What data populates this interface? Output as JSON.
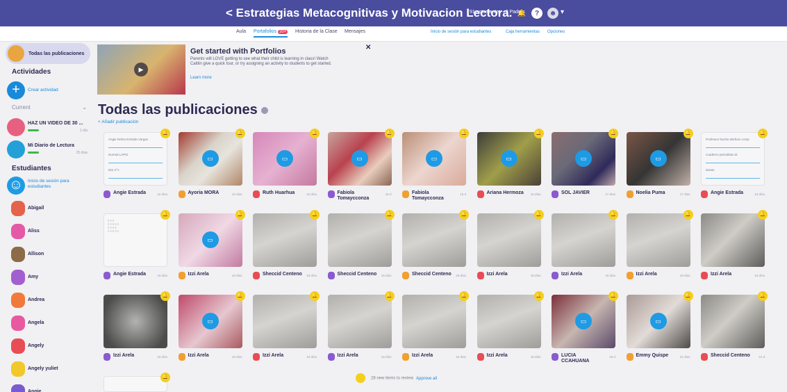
{
  "header": {
    "title": "Estrategias Metacognitivas y Motivacion Lectora.",
    "meta": "91 estudiantes · 2 Padres",
    "back_icon": "chevron-left-icon"
  },
  "tabs": [
    {
      "label": "Aula"
    },
    {
      "label": "Portafolios",
      "badge": "20+"
    },
    {
      "label": "Historia de la Clase"
    },
    {
      "label": "Mensajes"
    }
  ],
  "links": {
    "student_login": "Inicio de sesión para estudiantes",
    "toolbox": "Caja herramientas",
    "options": "Opciones"
  },
  "sidebar": {
    "all_posts": "Todas las publicaciones",
    "activities_heading": "Actividades",
    "create_activity": "Crear actividad",
    "current": "Current",
    "activities": [
      {
        "name": "HAZ UN VIDEO DE 30 ...",
        "days": "1 día"
      },
      {
        "name": "Mi Diario de Lectura",
        "days": "25 días"
      }
    ],
    "students_heading": "Estudiantes",
    "student_login": "Inicio de sesión para estudiantes",
    "students": [
      "Abigail",
      "Aliss",
      "Allison",
      "Amy",
      "Andrea",
      "Angela",
      "Angely",
      "Angely yuliet",
      "Angie"
    ]
  },
  "banner": {
    "title": "Get started with Portfolios",
    "desc": "Parents will LOVE getting to see what their child is learning in class! Watch Caitlin give a quick tour, or try assigning an activity to students to get started.",
    "learn": "Learn more"
  },
  "main": {
    "title": "Todas las publicaciones",
    "add": "+ Añadir publicación"
  },
  "posts": [
    {
      "name": "Angie Estrada",
      "date": "15 días",
      "kind": "doc",
      "fields": [
        "Angie Nohra Estrada Vargas",
        "Normal LAPIZ",
        "Dar 2°A"
      ]
    },
    {
      "name": "Ayoria MORA",
      "date": "16 días",
      "kind": "photo1",
      "cam": true
    },
    {
      "name": "Ruth Huarhua",
      "date": "16 días",
      "kind": "photo2",
      "cam": true
    },
    {
      "name": "Fabiola Tomaycconza",
      "date": "16 d",
      "kind": "photo3",
      "cam": true
    },
    {
      "name": "Fabiola Tomaycconza",
      "date": "16 d",
      "kind": "photo4",
      "cam": true
    },
    {
      "name": "Ariana Hermoza",
      "date": "16 días",
      "kind": "photo5",
      "cam": true
    },
    {
      "name": "SOL JAVIER",
      "date": "17 días",
      "kind": "photo6",
      "cam": true
    },
    {
      "name": "Noelia Puma",
      "date": "17 días",
      "kind": "photo7",
      "cam": true
    },
    {
      "name": "Angie Estrada",
      "date": "18 días",
      "kind": "doc",
      "fields": [
        "Professor burrito telefono comp",
        "cuaderno periodista cb",
        "tareas"
      ]
    },
    {
      "name": "Angie Estrada",
      "date": "18 días",
      "kind": "note"
    },
    {
      "name": "Izzi Arela",
      "date": "18 días",
      "kind": "photo8",
      "cam": true
    },
    {
      "name": "Sheccid Centeno",
      "date": "18 días",
      "kind": "gray"
    },
    {
      "name": "Sheccid Centeno",
      "date": "18 días",
      "kind": "gray"
    },
    {
      "name": "Sheccid Centeno",
      "date": "18 días",
      "kind": "gray"
    },
    {
      "name": "Izzi Arela",
      "date": "18 días",
      "kind": "gray"
    },
    {
      "name": "Izzi Arela",
      "date": "18 días",
      "kind": "gray"
    },
    {
      "name": "Izzi Arela",
      "date": "18 días",
      "kind": "gray"
    },
    {
      "name": "Izzi Arela",
      "date": "18 días",
      "kind": "photo13"
    },
    {
      "name": "Izzi Arela",
      "date": "18 días",
      "kind": "photo9"
    },
    {
      "name": "Izzi Arela",
      "date": "18 días",
      "kind": "photo10",
      "cam": true
    },
    {
      "name": "Izzi Arela",
      "date": "18 días",
      "kind": "gray"
    },
    {
      "name": "Izzi Arela",
      "date": "18 días",
      "kind": "gray"
    },
    {
      "name": "Izzi Arela",
      "date": "18 días",
      "kind": "gray"
    },
    {
      "name": "Izzi Arela",
      "date": "18 días",
      "kind": "gray"
    },
    {
      "name": "LUCIA CCAHUANA",
      "date": "19 d",
      "kind": "photo11",
      "cam": true
    },
    {
      "name": "Emmy Quispe",
      "date": "21 días",
      "kind": "photo12",
      "cam": true
    },
    {
      "name": "Sheccid Centeno",
      "date": "21 d",
      "kind": "photo13"
    }
  ],
  "more": {
    "text": "28 new items to review",
    "action": "Approve all"
  },
  "colors": {
    "header": "#4a4c9e",
    "accent": "#1a8ad8",
    "bell": "#f4cf1c"
  }
}
